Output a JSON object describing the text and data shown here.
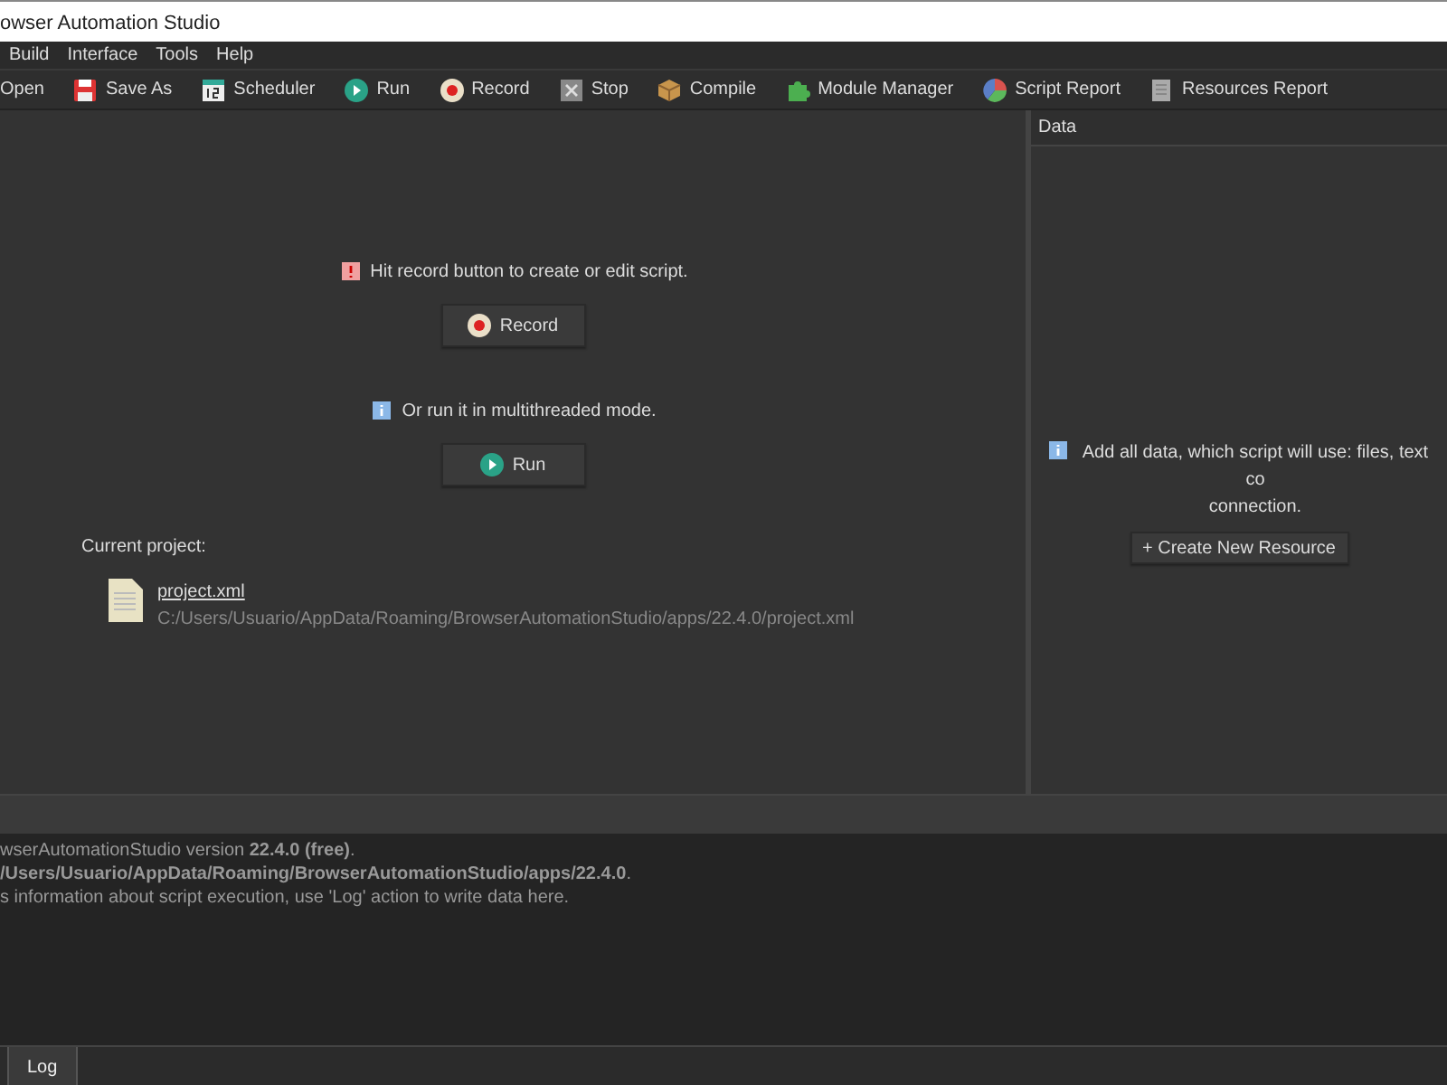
{
  "window": {
    "title": "owser Automation Studio"
  },
  "menu": [
    "Build",
    "Interface",
    "Tools",
    "Help"
  ],
  "toolbar": [
    "Open",
    "Save As",
    "Scheduler",
    "Run",
    "Record",
    "Stop",
    "Compile",
    "Module Manager",
    "Script Report",
    "Resources Report"
  ],
  "start_panel": {
    "record_hint": "Hit record button to create or edit script.",
    "record_button": "Record",
    "run_hint": "Or run it in multithreaded mode.",
    "run_button": "Run",
    "project_label": "Current project:",
    "project_file": "project.xml",
    "project_path": "C:/Users/Usuario/AppData/Roaming/BrowserAutomationStudio/apps/22.4.0/project.xml"
  },
  "data_panel": {
    "title": "Data",
    "hint_lines": [
      "Add all data, which script will use: files, text co",
      "connection."
    ],
    "create_button": "+ Create New Resource"
  },
  "log": {
    "lines": [
      "wserAutomationStudio version **22.4.0** **(free)**.",
      "**/Users/Usuario/AppData/Roaming/BrowserAutomationStudio/apps/22.4.0**.",
      "s information about script execution, use 'Log' action to write data here."
    ]
  },
  "bottom_tabs": [
    {
      "label": "Log",
      "selected": true
    }
  ]
}
